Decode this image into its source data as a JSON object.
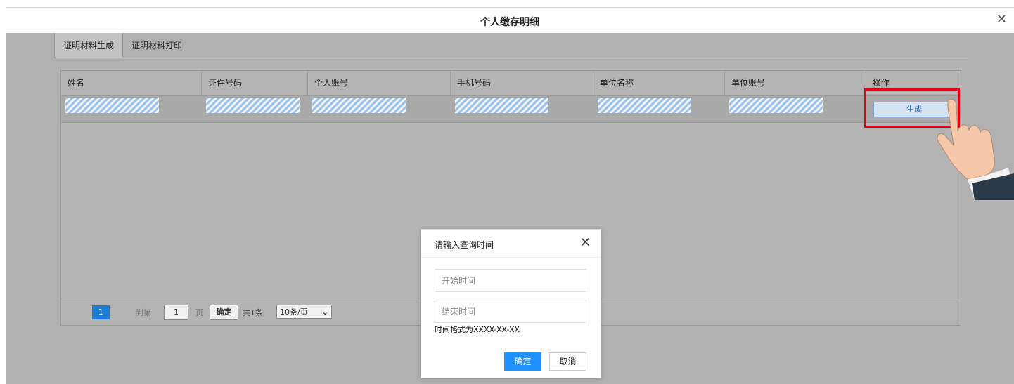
{
  "window": {
    "title": "个人缴存明细"
  },
  "tabs": [
    {
      "label": "证明材料生成",
      "active": true
    },
    {
      "label": "证明材料打印",
      "active": false
    }
  ],
  "table": {
    "columns": [
      "姓名",
      "证件号码",
      "个人账号",
      "手机号码",
      "单位名称",
      "单位账号",
      "操作"
    ],
    "rows": [
      {
        "action_label": "生成"
      }
    ]
  },
  "pagination": {
    "current_page": "1",
    "goto_label": "到第",
    "page_input": "1",
    "page_unit": "页",
    "confirm_label": "确定",
    "total_label": "共1条",
    "page_size": "10条/页"
  },
  "dialog": {
    "title": "请输入查询时间",
    "start_placeholder": "开始时间",
    "end_placeholder": "结束时间",
    "hint": "时间格式为XXXX-XX-XX",
    "confirm_label": "确定",
    "cancel_label": "取消"
  },
  "colors": {
    "highlight": "#e60012",
    "primary": "#1e90ff",
    "overlay": "#b1b1b1"
  }
}
